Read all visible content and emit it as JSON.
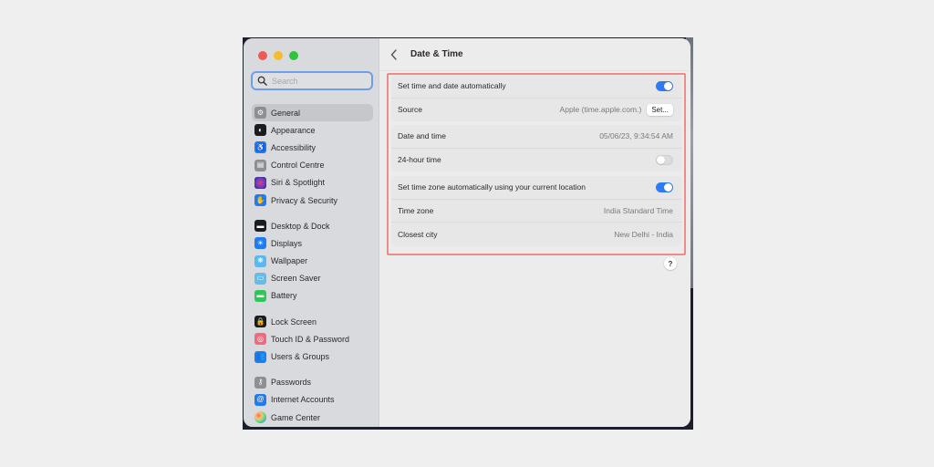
{
  "window": {
    "title": "Date & Time",
    "traffic_lights": [
      "close",
      "minimize",
      "zoom"
    ]
  },
  "sidebar": {
    "search": {
      "placeholder": "Search",
      "value": ""
    },
    "groups": [
      [
        {
          "label": "General",
          "icon": "gear-icon",
          "color": "#8e8e93",
          "glyph": "⚙",
          "active": true
        },
        {
          "label": "Appearance",
          "icon": "appearance-icon",
          "color": "#1c1c1e",
          "glyph": "◐"
        },
        {
          "label": "Accessibility",
          "icon": "accessibility-icon",
          "color": "#1a7cf2",
          "glyph": "♿"
        },
        {
          "label": "Control Centre",
          "icon": "control-centre-icon",
          "color": "#8e8e93",
          "glyph": "▤"
        },
        {
          "label": "Siri & Spotlight",
          "icon": "siri-icon",
          "color": "#7a3cc8",
          "glyph": "●"
        },
        {
          "label": "Privacy & Security",
          "icon": "hand-icon",
          "color": "#1f7cf0",
          "glyph": "✋"
        }
      ],
      [
        {
          "label": "Desktop & Dock",
          "icon": "dock-icon",
          "color": "#1c1c1e",
          "glyph": "▬"
        },
        {
          "label": "Displays",
          "icon": "sun-icon",
          "color": "#1f7cf0",
          "glyph": "☀"
        },
        {
          "label": "Wallpaper",
          "icon": "wallpaper-icon",
          "color": "#5ab8f0",
          "glyph": "❋"
        },
        {
          "label": "Screen Saver",
          "icon": "screen-saver-icon",
          "color": "#63bde8",
          "glyph": "▭"
        },
        {
          "label": "Battery",
          "icon": "battery-icon",
          "color": "#32c559",
          "glyph": "▬"
        }
      ],
      [
        {
          "label": "Lock Screen",
          "icon": "lock-icon",
          "color": "#1c1c1e",
          "glyph": "🔒"
        },
        {
          "label": "Touch ID & Password",
          "icon": "fingerprint-icon",
          "color": "#f06a7e",
          "glyph": "◎"
        },
        {
          "label": "Users & Groups",
          "icon": "users-icon",
          "color": "#1f7cf0",
          "glyph": "👥"
        }
      ],
      [
        {
          "label": "Passwords",
          "icon": "key-icon",
          "color": "#8e8e93",
          "glyph": "⚷"
        },
        {
          "label": "Internet Accounts",
          "icon": "at-icon",
          "color": "#1f7cf0",
          "glyph": "@"
        },
        {
          "label": "Game Center",
          "icon": "game-center-icon",
          "color": "#ffffff",
          "glyph": "●"
        }
      ]
    ]
  },
  "settings": {
    "group1": [
      {
        "label": "Set time and date automatically",
        "type": "toggle",
        "on": true
      },
      {
        "label": "Source",
        "type": "value-button",
        "value": "Apple (time.apple.com.)",
        "button": "Set..."
      }
    ],
    "group2": [
      {
        "label": "Date and time",
        "type": "value",
        "value": "05/06/23, 9:34:54 AM"
      },
      {
        "label": "24-hour time",
        "type": "toggle",
        "on": false
      }
    ],
    "group3": [
      {
        "label": "Set time zone automatically using your current location",
        "type": "toggle",
        "on": true
      },
      {
        "label": "Time zone",
        "type": "value",
        "value": "India Standard Time"
      },
      {
        "label": "Closest city",
        "type": "value",
        "value": "New Delhi - India"
      }
    ]
  },
  "help": {
    "label": "?"
  },
  "colors": {
    "accent": "#2f7bf5",
    "highlight_border": "#ee8b8a"
  }
}
